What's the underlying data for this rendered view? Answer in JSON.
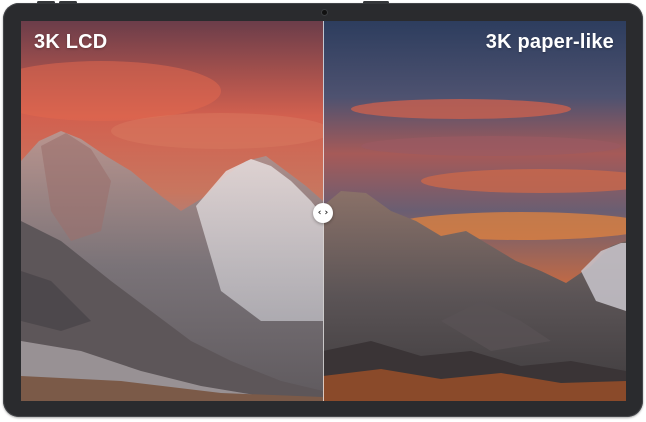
{
  "comparison": {
    "left_label": "3K LCD",
    "right_label": "3K paper-like",
    "slider_glyph": "‹ ›"
  },
  "icons": {
    "slider_handle": "compare-arrows-icon"
  },
  "colors": {
    "bezel": "#2a2b2e",
    "label_text": "#ffffff",
    "divider": "#ffffff"
  }
}
